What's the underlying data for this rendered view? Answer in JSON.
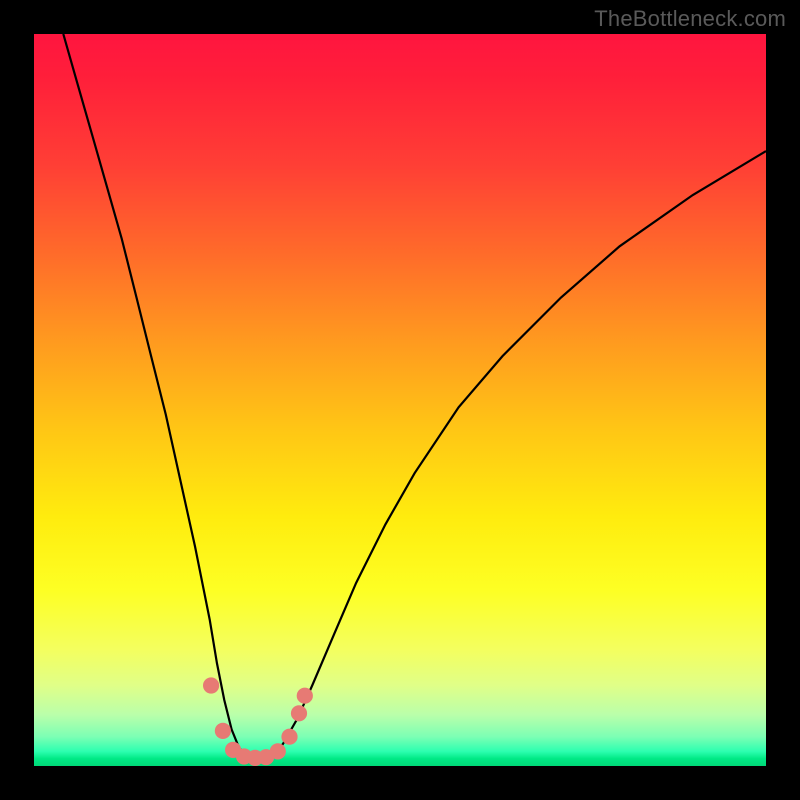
{
  "watermark": "TheBottleneck.com",
  "colors": {
    "frame": "#000000",
    "gradient_top": "#ff153f",
    "gradient_bottom": "#00d878",
    "curve": "#000000",
    "markers": "#e77a74"
  },
  "chart_data": {
    "type": "line",
    "title": "",
    "xlabel": "",
    "ylabel": "",
    "xlim": [
      0,
      100
    ],
    "ylim": [
      0,
      100
    ],
    "series": [
      {
        "name": "bottleneck-curve",
        "x": [
          4,
          6,
          8,
          10,
          12,
          14,
          16,
          18,
          20,
          22,
          24,
          25,
          26,
          27,
          28,
          29,
          30,
          31,
          32,
          33,
          34,
          36,
          38,
          41,
          44,
          48,
          52,
          58,
          64,
          72,
          80,
          90,
          100
        ],
        "y": [
          100,
          93,
          86,
          79,
          72,
          64,
          56,
          48,
          39,
          30,
          20,
          14,
          9,
          5,
          2.5,
          1.3,
          1,
          1,
          1.2,
          1.8,
          3,
          6.5,
          11,
          18,
          25,
          33,
          40,
          49,
          56,
          64,
          71,
          78,
          84
        ]
      }
    ],
    "markers": [
      {
        "x": 24.2,
        "y": 11.0,
        "r": 1.1
      },
      {
        "x": 25.8,
        "y": 4.8,
        "r": 1.1
      },
      {
        "x": 27.2,
        "y": 2.2,
        "r": 1.1
      },
      {
        "x": 28.7,
        "y": 1.3,
        "r": 1.1
      },
      {
        "x": 30.2,
        "y": 1.1,
        "r": 1.1
      },
      {
        "x": 31.7,
        "y": 1.2,
        "r": 1.1
      },
      {
        "x": 33.3,
        "y": 2.0,
        "r": 1.1
      },
      {
        "x": 34.9,
        "y": 4.0,
        "r": 1.1
      },
      {
        "x": 36.2,
        "y": 7.2,
        "r": 1.1
      },
      {
        "x": 37.0,
        "y": 9.6,
        "r": 1.1
      }
    ]
  }
}
